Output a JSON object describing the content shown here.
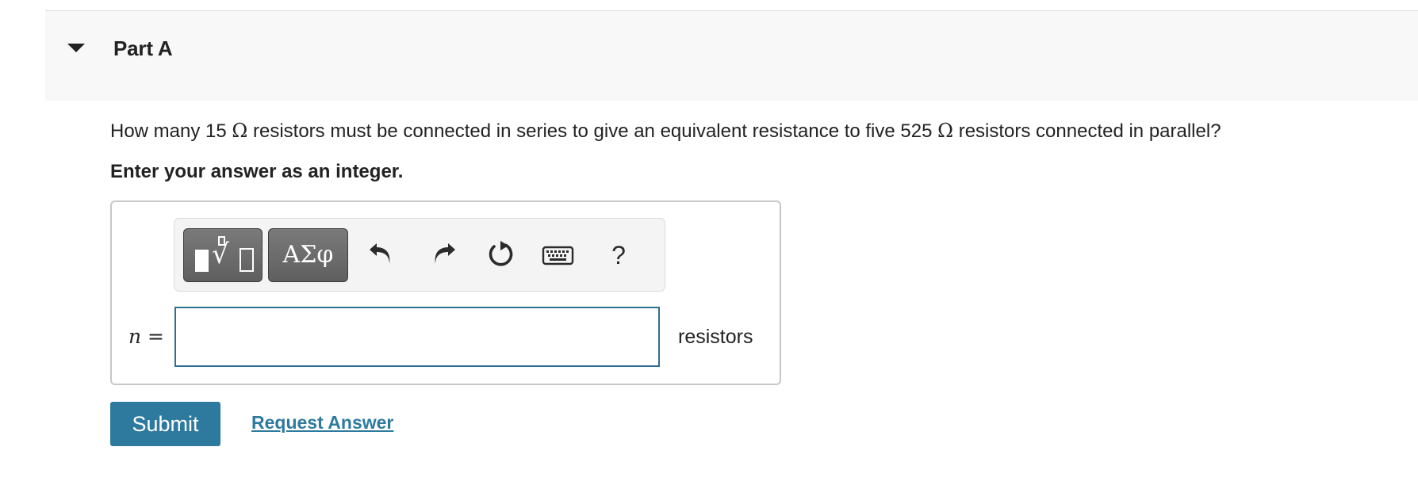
{
  "part": {
    "title": "Part A",
    "expanded": true
  },
  "question": {
    "segments": [
      "How many 15 ",
      "Ω",
      " resistors must be connected in series to give an equivalent resistance to five 525 ",
      "Ω",
      " resistors connected in parallel?"
    ],
    "instruction": "Enter your answer as an integer."
  },
  "toolbar": {
    "symbols_label": "ΑΣφ",
    "help_label": "?",
    "icons": [
      "templates-icon",
      "greek-symbols",
      "undo-icon",
      "redo-icon",
      "reset-icon",
      "keyboard-icon",
      "help-icon"
    ]
  },
  "answer": {
    "variable": "n",
    "equals": " =",
    "value": "",
    "placeholder": "",
    "units": "resistors"
  },
  "actions": {
    "submit_label": "Submit",
    "request_label": "Request Answer"
  },
  "colors": {
    "accent": "#2e7a9e",
    "input_border": "#2f6f8f",
    "header_bg": "#f8f8f8",
    "panel_border": "#c8c8c8"
  }
}
